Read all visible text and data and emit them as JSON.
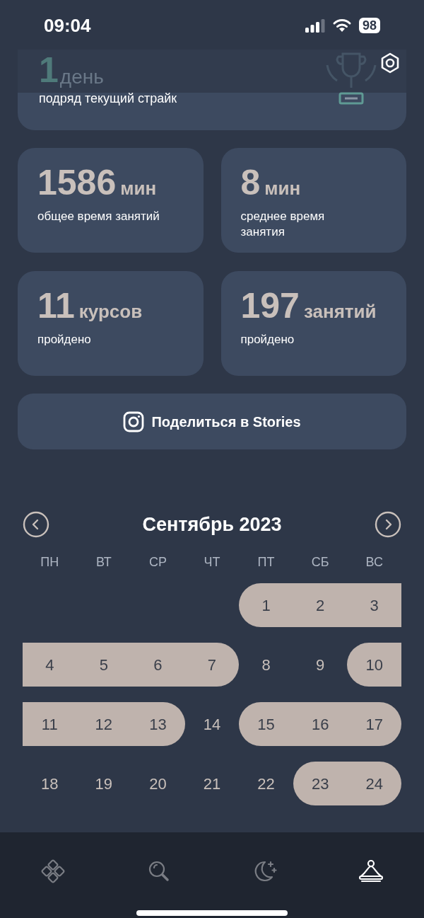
{
  "status_bar": {
    "time": "09:04",
    "battery": "98"
  },
  "streak": {
    "value": "1",
    "unit": "день",
    "label": "подряд текущий страйк"
  },
  "stats": [
    {
      "value": "1586",
      "unit": "мин",
      "label": "общее время занятий"
    },
    {
      "value": "8",
      "unit": "мин",
      "label": "среднее время занятия"
    },
    {
      "value": "11",
      "unit": "курсов",
      "label": "пройдено"
    },
    {
      "value": "197",
      "unit": "занятий",
      "label": "пройдено"
    }
  ],
  "share_button": {
    "label": "Поделиться в Stories"
  },
  "calendar": {
    "title": "Сентябрь 2023",
    "weekdays": [
      "ПН",
      "ВТ",
      "СР",
      "ЧТ",
      "ПТ",
      "СБ",
      "ВС"
    ],
    "weeks": [
      [
        {
          "day": "1",
          "active": true
        },
        {
          "day": "2",
          "active": true
        },
        {
          "day": "3",
          "active": true
        }
      ],
      [
        {
          "day": "4",
          "active": true
        },
        {
          "day": "5",
          "active": true
        },
        {
          "day": "6",
          "active": true
        },
        {
          "day": "7",
          "active": true
        },
        {
          "day": "8",
          "active": false
        },
        {
          "day": "9",
          "active": false
        },
        {
          "day": "10",
          "active": true
        }
      ],
      [
        {
          "day": "11",
          "active": true
        },
        {
          "day": "12",
          "active": true
        },
        {
          "day": "13",
          "active": true
        },
        {
          "day": "14",
          "active": false
        },
        {
          "day": "15",
          "active": true
        },
        {
          "day": "16",
          "active": true
        },
        {
          "day": "17",
          "active": true
        }
      ],
      [
        {
          "day": "18",
          "active": false
        },
        {
          "day": "19",
          "active": false
        },
        {
          "day": "20",
          "active": false
        },
        {
          "day": "21",
          "active": false
        },
        {
          "day": "22",
          "active": false
        },
        {
          "day": "23",
          "active": true
        },
        {
          "day": "24",
          "active": true
        }
      ]
    ]
  },
  "nav": [
    {
      "kind": "practices",
      "selected": false
    },
    {
      "kind": "search",
      "selected": false
    },
    {
      "kind": "sleep",
      "selected": false
    },
    {
      "kind": "profile",
      "selected": true
    }
  ]
}
